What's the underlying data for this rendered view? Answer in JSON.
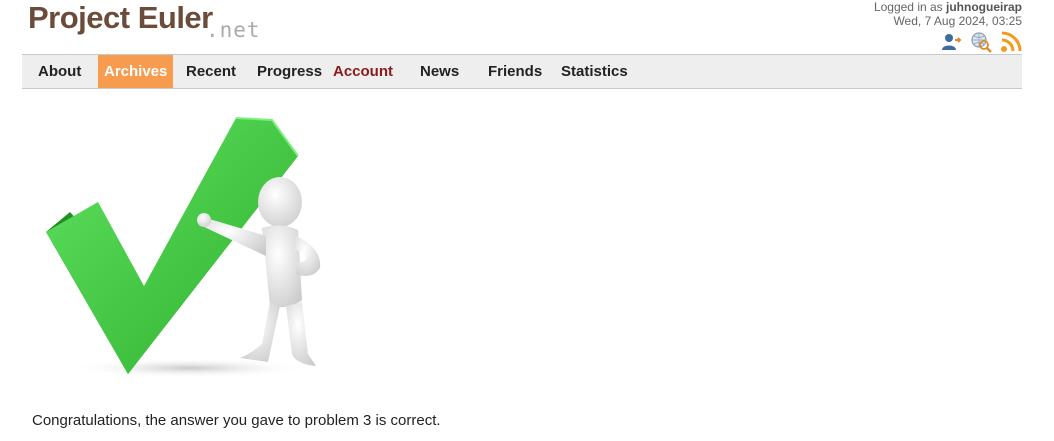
{
  "header": {
    "logo_main": "Project Euler",
    "logo_suffix": ".net",
    "logged_in_prefix": "Logged in as ",
    "username": "juhnogueirap",
    "datetime": "Wed, 7 Aug 2024, 03:25",
    "icons": [
      "user-logout-icon",
      "search-globe-icon",
      "rss-icon"
    ]
  },
  "nav": {
    "items": [
      {
        "label": "About",
        "state": "normal"
      },
      {
        "label": "Archives",
        "state": "active"
      },
      {
        "label": "Recent",
        "state": "normal"
      },
      {
        "label": "Progress",
        "state": "normal"
      },
      {
        "label": "Account",
        "state": "highlight"
      },
      {
        "label": "News",
        "state": "normal"
      },
      {
        "label": "Friends",
        "state": "normal"
      },
      {
        "label": "Statistics",
        "state": "normal"
      }
    ],
    "colors": {
      "active_bg": "#f79b4f",
      "account": "#8b1a1a"
    }
  },
  "main": {
    "image": "green-checkmark-with-figure",
    "message": "Congratulations, the answer you gave to problem 3 is correct."
  }
}
